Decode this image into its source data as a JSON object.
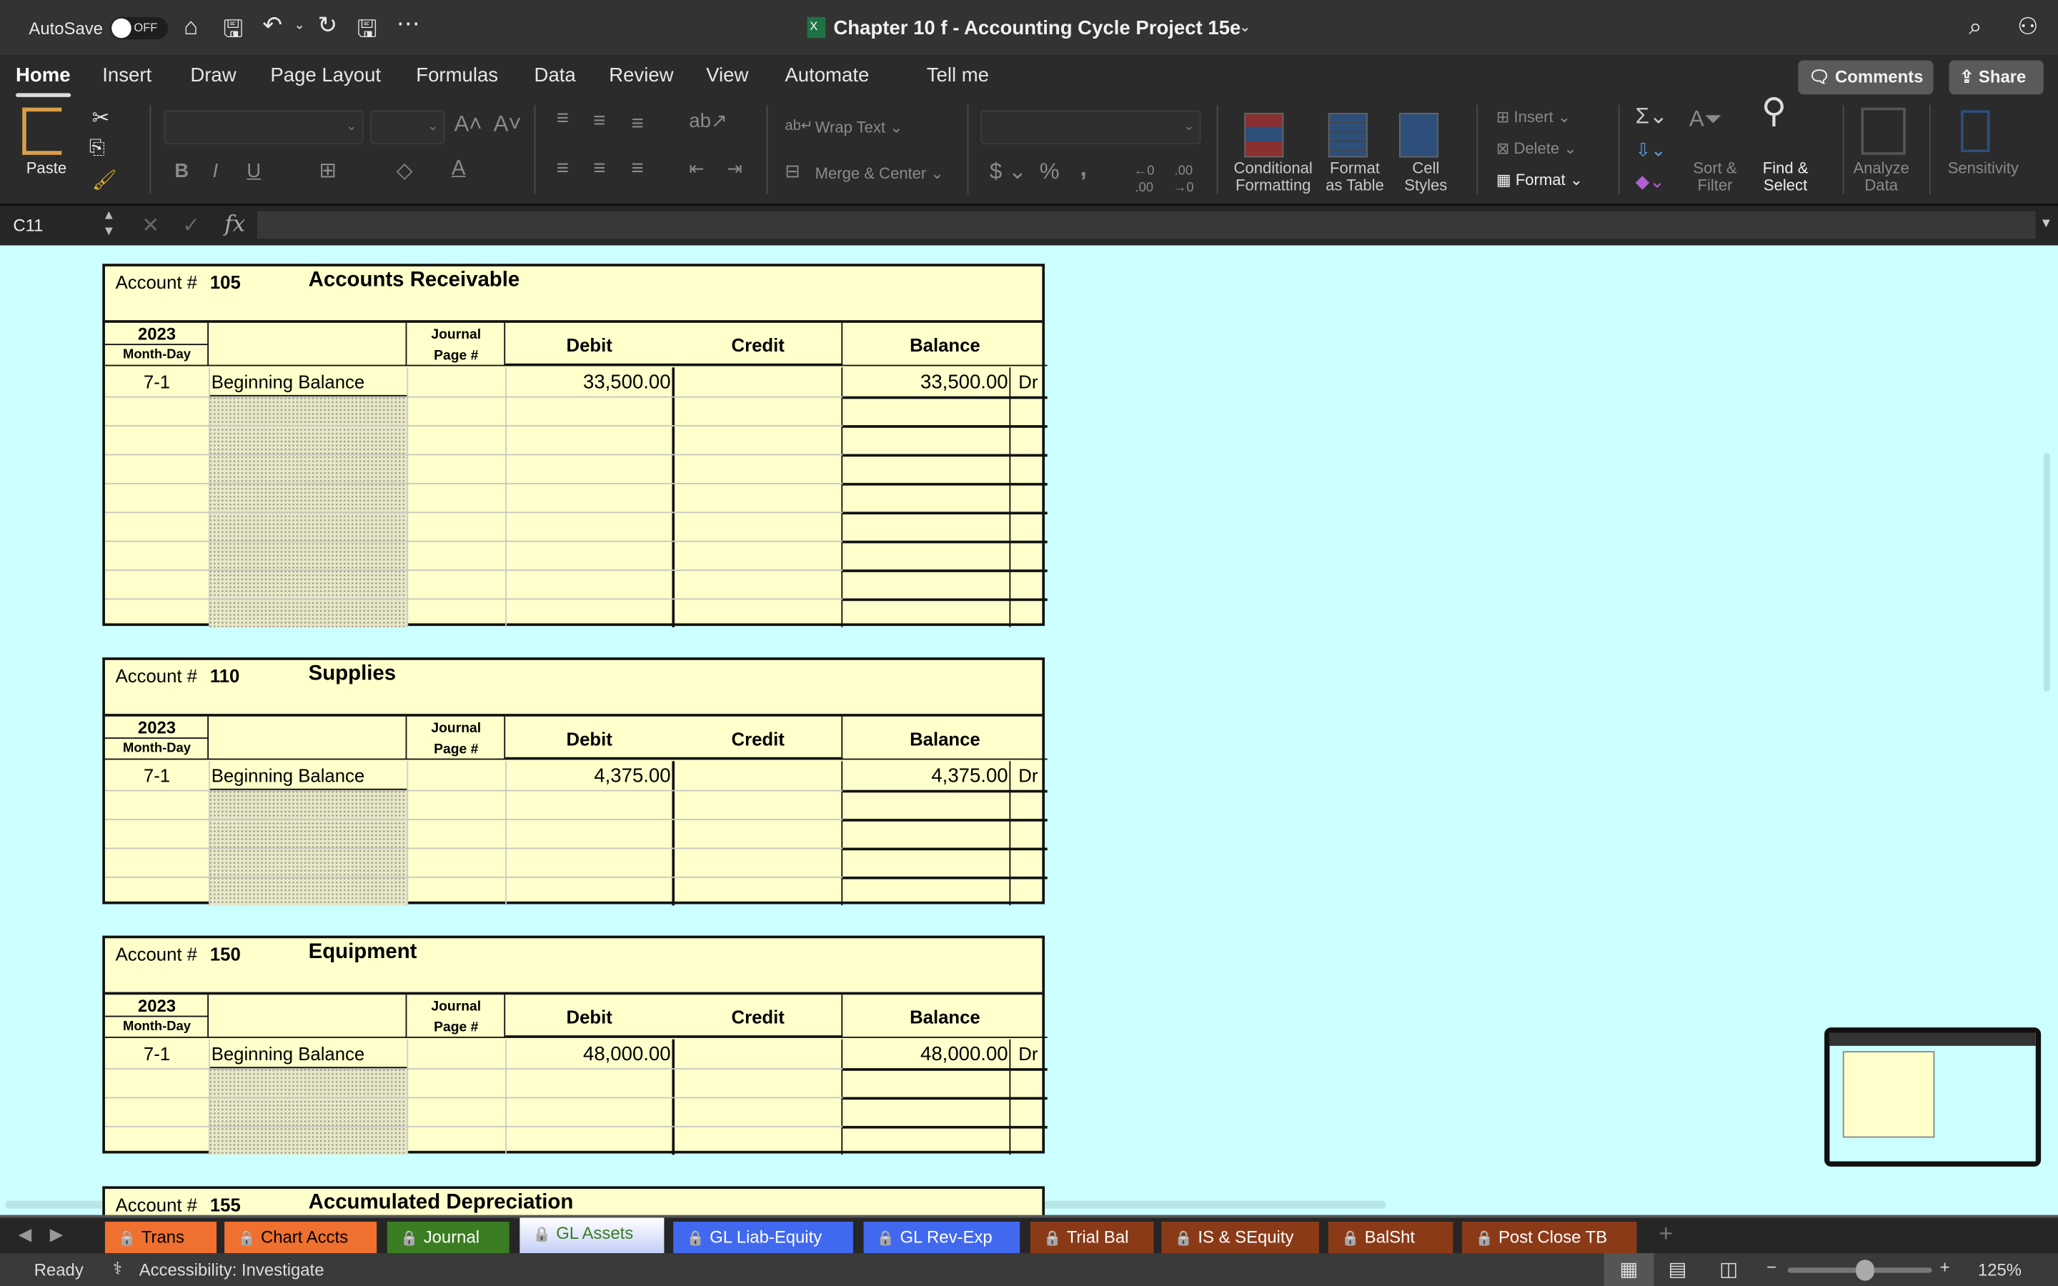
{
  "titlebar": {
    "autosave_label": "AutoSave",
    "autosave_state": "OFF",
    "document_title": "Chapter 10 f - Accounting Cycle Project 15e"
  },
  "ribbon_tabs": [
    "Home",
    "Insert",
    "Draw",
    "Page Layout",
    "Formulas",
    "Data",
    "Review",
    "View",
    "Automate",
    "Tell me"
  ],
  "active_tab": "Home",
  "buttons": {
    "comments": "Comments",
    "share": "Share"
  },
  "ribbon": {
    "paste": "Paste",
    "wrap_text": "Wrap Text",
    "merge_center": "Merge & Center",
    "conditional_formatting": [
      "Conditional",
      "Formatting"
    ],
    "format_as_table": [
      "Format",
      "as Table"
    ],
    "cell_styles": [
      "Cell",
      "Styles"
    ],
    "insert": "Insert",
    "delete": "Delete",
    "format": "Format",
    "sort_filter": [
      "Sort &",
      "Filter"
    ],
    "find_select": [
      "Find &",
      "Select"
    ],
    "analyze_data": [
      "Analyze",
      "Data"
    ],
    "sensitivity": "Sensitivity",
    "bold": "B",
    "italic": "I",
    "underline": "U"
  },
  "formula_bar": {
    "cell_ref": "C11",
    "fx": "fx",
    "value": ""
  },
  "ledger_headers": {
    "account_label": "Account #",
    "year": "2023",
    "month_day": "Month-Day",
    "journal": "Journal",
    "page": "Page #",
    "debit": "Debit",
    "credit": "Credit",
    "balance": "Balance"
  },
  "ledgers": [
    {
      "number": "105",
      "name": "Accounts Receivable",
      "entries": [
        {
          "date": "7-1",
          "description": "Beginning Balance",
          "journal": "",
          "debit": "33,500.00",
          "credit": "",
          "balance": "33,500.00",
          "side": "Dr"
        }
      ],
      "empty_rows": 8
    },
    {
      "number": "110",
      "name": "Supplies",
      "entries": [
        {
          "date": "7-1",
          "description": "Beginning Balance",
          "journal": "",
          "debit": "4,375.00",
          "credit": "",
          "balance": "4,375.00",
          "side": "Dr"
        }
      ],
      "empty_rows": 4
    },
    {
      "number": "150",
      "name": "Equipment",
      "entries": [
        {
          "date": "7-1",
          "description": "Beginning Balance",
          "journal": "",
          "debit": "48,000.00",
          "credit": "",
          "balance": "48,000.00",
          "side": "Dr"
        }
      ],
      "empty_rows": 3
    },
    {
      "number": "155",
      "name": "Accumulated Depreciation",
      "entries": [],
      "empty_rows": 0
    }
  ],
  "sheet_tabs": [
    {
      "label": "Trans",
      "bg": "#f07030",
      "fg": "#000000"
    },
    {
      "label": "Chart Accts",
      "bg": "#f07030",
      "fg": "#000000"
    },
    {
      "label": "Journal",
      "bg": "#3a7d22",
      "fg": "#ffffff"
    },
    {
      "label": "GL Assets",
      "bg": "#c4cff8",
      "fg": "#3a7d22",
      "active": true
    },
    {
      "label": "GL Liab-Equity",
      "bg": "#4169f0",
      "fg": "#ffffff"
    },
    {
      "label": "GL Rev-Exp",
      "bg": "#4169f0",
      "fg": "#ffffff"
    },
    {
      "label": "Trial Bal",
      "bg": "#8b3a18",
      "fg": "#ffffff"
    },
    {
      "label": "IS & SEquity",
      "bg": "#8b3a18",
      "fg": "#ffffff"
    },
    {
      "label": "BalSht",
      "bg": "#8b3a18",
      "fg": "#ffffff"
    },
    {
      "label": "Post Close TB",
      "bg": "#8b3a18",
      "fg": "#ffffff"
    }
  ],
  "status": {
    "ready": "Ready",
    "accessibility": "Accessibility: Investigate",
    "zoom": "125%",
    "zoom_percent": 125
  },
  "colors": {
    "sheet_bg": "#ccffff",
    "ledger_bg": "#ffffcc"
  }
}
